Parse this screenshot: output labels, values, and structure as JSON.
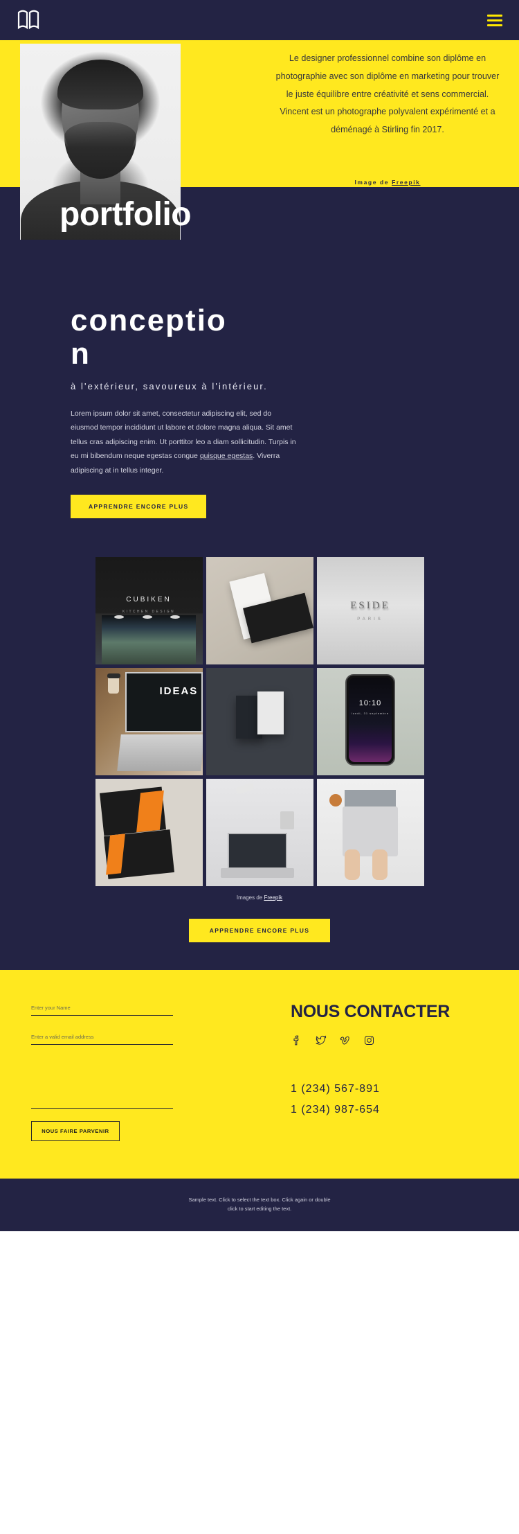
{
  "header": {
    "logo_name": "book-logo",
    "menu_name": "hamburger-menu"
  },
  "hero": {
    "paragraph": "Le designer professionnel combine son diplôme en photographie avec son diplôme en marketing pour trouver le juste équilibre entre créativité et sens commercial. Vincent est un photographe polyvalent expérimenté et a déménagé à Stirling fin 2017.",
    "credit_prefix": "Image de ",
    "credit_link": "Freepik",
    "arrow": "❯",
    "portfolio_word": "portfolio"
  },
  "concept": {
    "title": "conception",
    "subtitle": "à l'extérieur, savoureux à l'intérieur.",
    "body_part1": "Lorem ipsum dolor sit amet, consectetur adipiscing elit, sed do eiusmod tempor incididunt ut labore et dolore magna aliqua. Sit amet tellus cras adipiscing enim. Ut porttitor leo a diam sollicitudin. Turpis in eu mi bibendum neque egestas congue ",
    "body_link": "quisque egestas",
    "body_part2": ". Viverra adipiscing at in tellus integer.",
    "button": "APPRENDRE ENCORE PLUS"
  },
  "gallery": {
    "tiles": [
      {
        "name": "cubiken-storefront",
        "brand": "CUBIKEN",
        "brandsub": "KITCHEN DESIGN"
      },
      {
        "name": "business-cards-mockup",
        "brand": "",
        "brandsub": ""
      },
      {
        "name": "eside-paris-logo",
        "brand": "ESIDE",
        "brandsub": "PARIS"
      },
      {
        "name": "ideas-laptop",
        "brand": "IDEAS",
        "brandsub": ""
      },
      {
        "name": "dark-business-cards",
        "brand": "",
        "brandsub": ""
      },
      {
        "name": "smartphone-mockup",
        "brand": "10:10",
        "brandsub": "lundi, 31 septembre"
      },
      {
        "name": "orange-design-cards",
        "brand": "",
        "brandsub": ""
      },
      {
        "name": "desk-workspace",
        "brand": "",
        "brandsub": ""
      },
      {
        "name": "hands-on-laptop",
        "brand": "",
        "brandsub": ""
      }
    ],
    "credit_prefix": "Images de ",
    "credit_link": "Freepik",
    "button": "APPRENDRE ENCORE PLUS"
  },
  "contact": {
    "title": "NOUS CONTACTER",
    "name_placeholder": "Enter your Name",
    "email_placeholder": "Enter a valid email address",
    "message_placeholder": "",
    "submit_label": "NOUS FAIRE PARVENIR",
    "socials": [
      {
        "name": "facebook-icon"
      },
      {
        "name": "twitter-icon"
      },
      {
        "name": "vimeo-icon"
      },
      {
        "name": "instagram-icon"
      }
    ],
    "phone1": "1 (234) 567-891",
    "phone2": "1 (234) 987-654"
  },
  "footer": {
    "line1": "Sample text. Click to select the text box. Click again or double",
    "line2": "click to start editing the text."
  },
  "colors": {
    "navy": "#232344",
    "yellow": "#ffe81f"
  }
}
